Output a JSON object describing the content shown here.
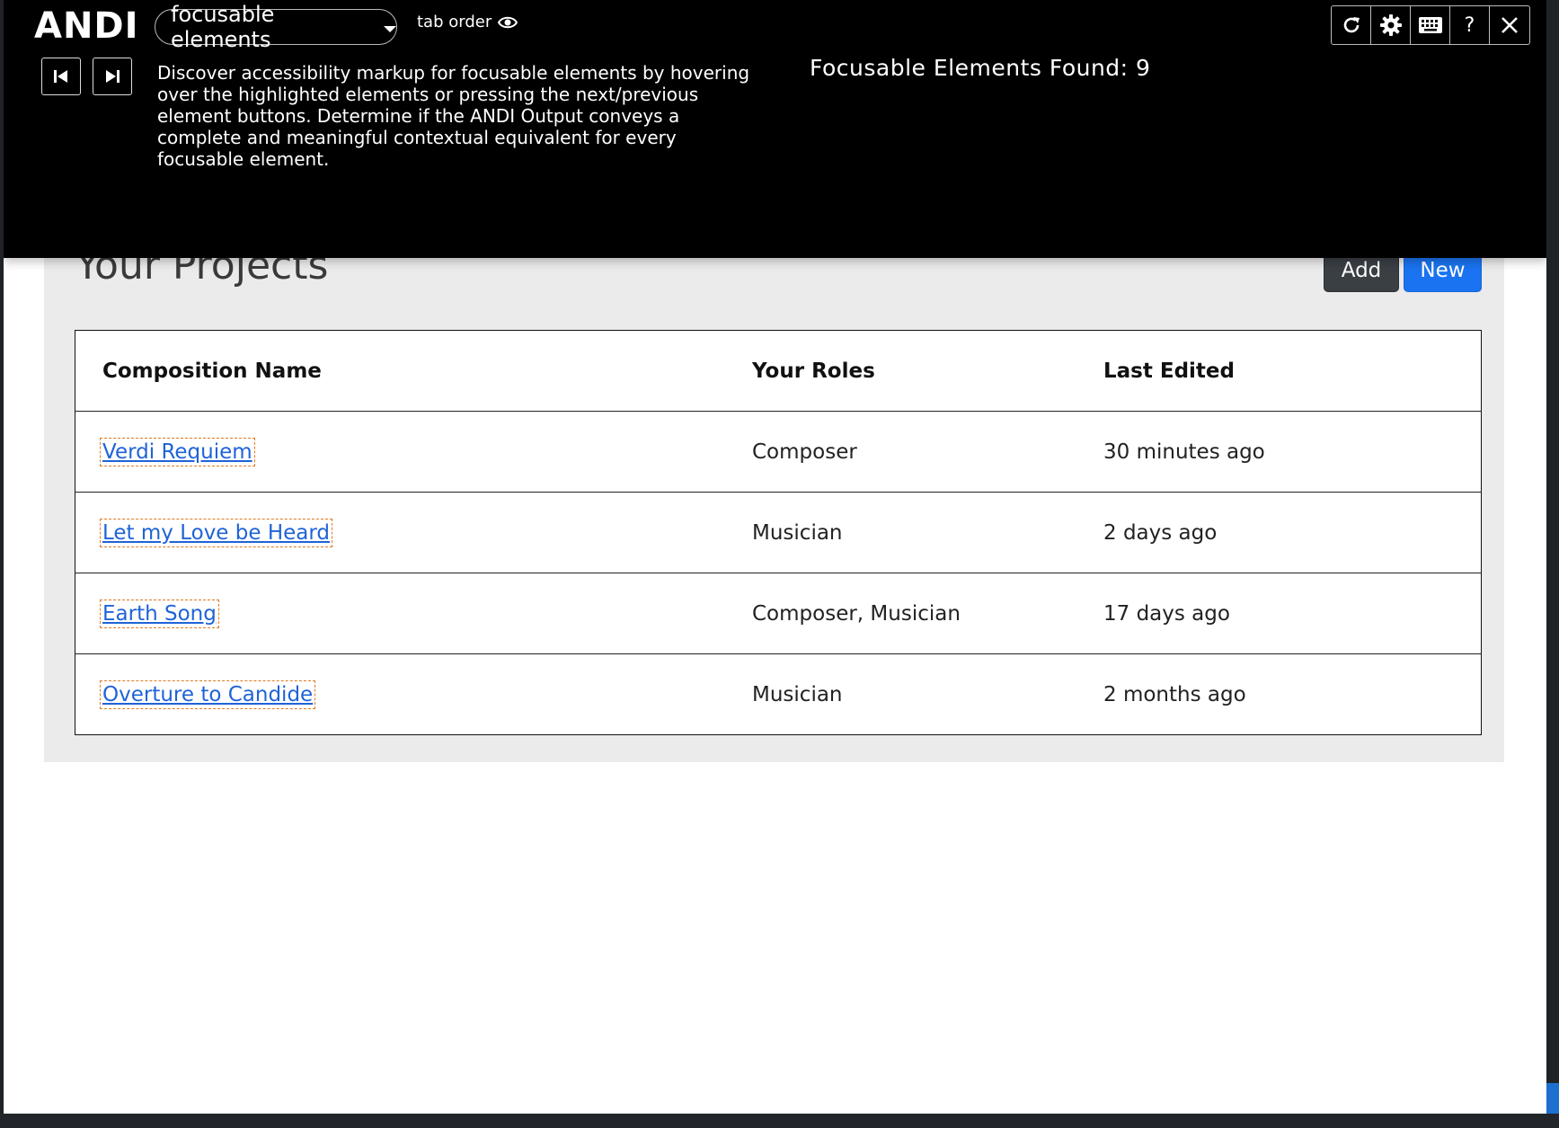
{
  "andi": {
    "logo": "ANDI",
    "module": "focusable elements",
    "tab_order_label": "tab order",
    "instructions": "Discover accessibility markup for focusable elements by hovering over the highlighted elements or pressing the next/previous element buttons. Determine if the ANDI Output conveys a complete and meaningful contextual equivalent for every focusable element.",
    "found_text": "Focusable Elements Found: 9",
    "tools": [
      {
        "icon": "refresh-icon"
      },
      {
        "icon": "gear-icon"
      },
      {
        "icon": "keyboard-icon"
      },
      {
        "icon": "help-icon",
        "text": "?"
      },
      {
        "icon": "close-icon"
      }
    ]
  },
  "page": {
    "title": "Your Projects",
    "add_label": "Add",
    "new_label": "New"
  },
  "table": {
    "headers": [
      "Composition Name",
      "Your Roles",
      "Last Edited"
    ],
    "rows": [
      {
        "name": "Verdi Requiem",
        "roles": "Composer",
        "edited": "30 minutes ago"
      },
      {
        "name": "Let my Love be Heard",
        "roles": "Musician",
        "edited": "2 days ago"
      },
      {
        "name": "Earth Song",
        "roles": "Composer, Musician",
        "edited": "17 days ago"
      },
      {
        "name": "Overture to Candide",
        "roles": "Musician",
        "edited": "2 months ago"
      }
    ]
  },
  "colors": {
    "andi_bar": "#000000",
    "link": "#1f63d8",
    "focus_outline": "#e07a1f",
    "new_button": "#1a73f0",
    "add_button": "#3a3f44",
    "panel": "#ebebeb"
  }
}
